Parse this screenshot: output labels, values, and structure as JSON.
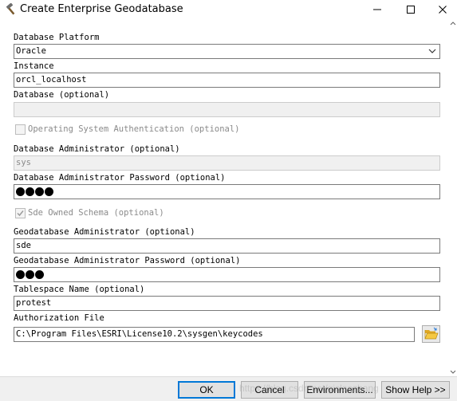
{
  "window": {
    "title": "Create Enterprise Geodatabase",
    "minimize_glyph": "—",
    "maximize_glyph": "☐",
    "close_glyph": "✕",
    "app_icon": "hammer-icon"
  },
  "form": {
    "platform_label": "Database Platform",
    "platform_value": "Oracle",
    "instance_label": "Instance",
    "instance_value": "orcl_localhost",
    "database_label": "Database (optional)",
    "database_value": "",
    "os_auth_label": "Operating System Authentication (optional)",
    "os_auth_checked": false,
    "db_admin_label": "Database Administrator (optional)",
    "db_admin_value": "sys",
    "db_admin_password_label": "Database Administrator Password (optional)",
    "db_admin_password_length": 4,
    "sde_schema_label": "Sde Owned Schema (optional)",
    "sde_schema_checked": true,
    "gdb_admin_label": "Geodatabase Administrator (optional)",
    "gdb_admin_value": "sde",
    "gdb_admin_password_label": "Geodatabase Administrator Password (optional)",
    "gdb_admin_password_length": 3,
    "tablespace_label": "Tablespace Name (optional)",
    "tablespace_value": "protest",
    "auth_file_label": "Authorization File",
    "auth_file_value": "C:\\Program Files\\ESRI\\License10.2\\sysgen\\keycodes",
    "browse_icon": "folder-open-icon"
  },
  "buttons": {
    "ok": "OK",
    "cancel": "Cancel",
    "environments": "Environments...",
    "show_help": "Show Help >>"
  },
  "watermark": "https://blog.csdn.net/gislaozhang"
}
